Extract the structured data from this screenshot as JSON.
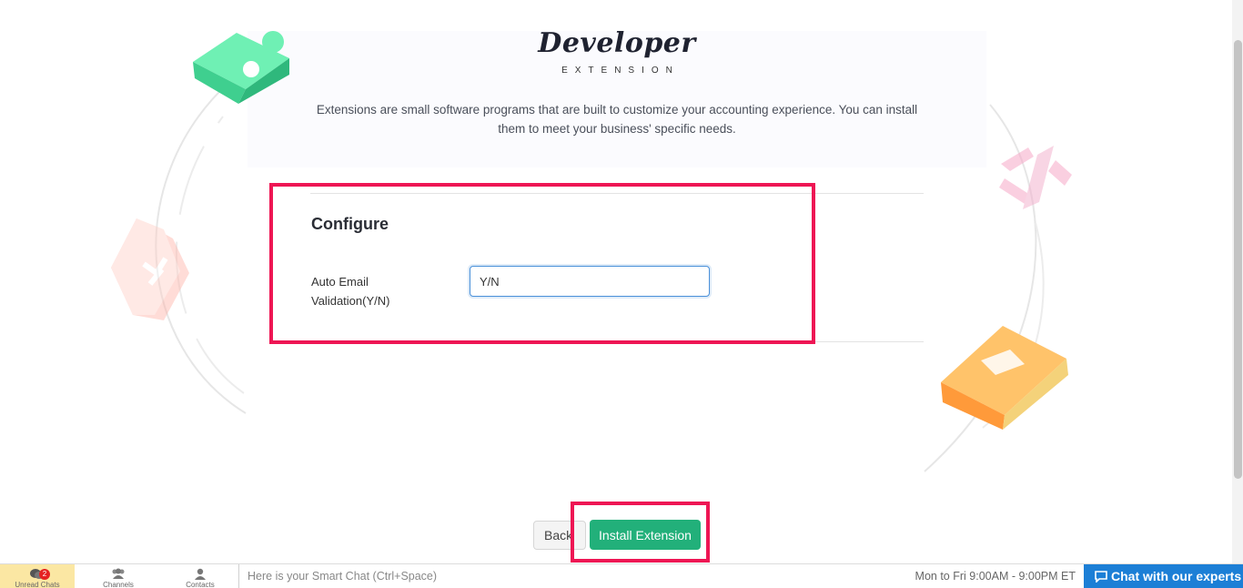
{
  "header": {
    "title": "Developer",
    "subtitle": "EXTENSION",
    "description": "Extensions are small software programs that are built to customize your accounting experience. You can install them to meet your business' specific needs."
  },
  "configure": {
    "title": "Configure",
    "fields": [
      {
        "label": "Auto Email Validation(Y/N)",
        "value": "Y/N"
      }
    ]
  },
  "actions": {
    "back_label": "Back",
    "install_label": "Install Extension"
  },
  "chatbar": {
    "unread_label": "Unread Chats",
    "unread_count": "2",
    "channels_label": "Channels",
    "contacts_label": "Contacts",
    "smart_chat_placeholder": "Here is your Smart Chat (Ctrl+Space)",
    "hours": "Mon to Fri 9:00AM - 9:00PM ET",
    "chat_experts_label": "Chat with our experts"
  },
  "colors": {
    "highlight": "#ee1654",
    "install_button": "#22b07a",
    "chat_experts_bg": "#1c7fd6",
    "unread_tab_bg": "#fbe7a3"
  },
  "icons": [
    "puzzle-piece-icon",
    "code-tag-icon",
    "handshake-icon",
    "package-box-icon",
    "chat-bubbles-icon",
    "users-icon",
    "user-icon",
    "chat-icon"
  ]
}
